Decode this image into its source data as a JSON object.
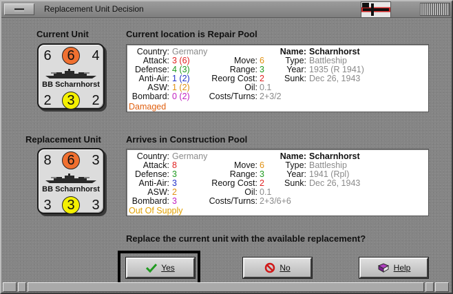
{
  "window": {
    "title": "Replacement Unit Decision"
  },
  "current": {
    "heading": "Current Unit",
    "location": "Current location is Repair Pool",
    "counter": {
      "top_left": "6",
      "top_mid": "6",
      "top_right": "4",
      "name": "BB Scharnhorst",
      "bot_left": "2",
      "bot_mid": "3",
      "bot_right": "2"
    },
    "stats": {
      "country_k": "Country:",
      "country_v": "Germany",
      "attack_k": "Attack:",
      "attack_v": "3 (6)",
      "defense_k": "Defense:",
      "defense_v": "4 (3)",
      "antiair_k": "Anti-Air:",
      "antiair_v": "1 (2)",
      "asw_k": "ASW:",
      "asw_v": "1 (2)",
      "bombard_k": "Bombard:",
      "bombard_v": "0 (2)",
      "status": "Damaged",
      "move_k": "Move:",
      "move_v": "6",
      "range_k": "Range:",
      "range_v": "3",
      "reorg_k": "Reorg Cost:",
      "reorg_v": "2",
      "oil_k": "Oil:",
      "oil_v": "0.1",
      "costs_k": "Costs/Turns:",
      "costs_v": "2+3/2",
      "name_k": "Name:",
      "name_v": "Scharnhorst",
      "type_k": "Type:",
      "type_v": "Battleship",
      "year_k": "Year:",
      "year_v": "1935 (R 1941)",
      "sunk_k": "Sunk:",
      "sunk_v": "Dec 26, 1943"
    }
  },
  "replacement": {
    "heading": "Replacement Unit",
    "location": "Arrives in Construction Pool",
    "counter": {
      "top_left": "8",
      "top_mid": "6",
      "top_right": "3",
      "name": "BB Scharnhorst",
      "bot_left": "3",
      "bot_mid": "3",
      "bot_right": "3"
    },
    "stats": {
      "country_k": "Country:",
      "country_v": "Germany",
      "attack_k": "Attack:",
      "attack_v": "8",
      "defense_k": "Defense:",
      "defense_v": "3",
      "antiair_k": "Anti-Air:",
      "antiair_v": "3",
      "asw_k": "ASW:",
      "asw_v": "2",
      "bombard_k": "Bombard:",
      "bombard_v": "3",
      "status": "Out Of Supply",
      "move_k": "Move:",
      "move_v": "6",
      "range_k": "Range:",
      "range_v": "3",
      "reorg_k": "Reorg Cost:",
      "reorg_v": "2",
      "oil_k": "Oil:",
      "oil_v": "0.1",
      "costs_k": "Costs/Turns:",
      "costs_v": "2+3/6+6",
      "name_k": "Name:",
      "name_v": "Scharnhorst",
      "type_k": "Type:",
      "type_v": "Battleship",
      "year_k": "Year:",
      "year_v": "1941 (Rpl)",
      "sunk_k": "Sunk:",
      "sunk_v": "Dec 26, 1943"
    }
  },
  "question": "Replace the current unit with the available replacement?",
  "buttons": {
    "yes": "Yes",
    "no": "No",
    "help": "Help"
  },
  "icons": {
    "yes": "checkmark-icon",
    "no": "no-sign-icon",
    "help": "help-book-icon",
    "flag": "german-war-flag-icon"
  }
}
